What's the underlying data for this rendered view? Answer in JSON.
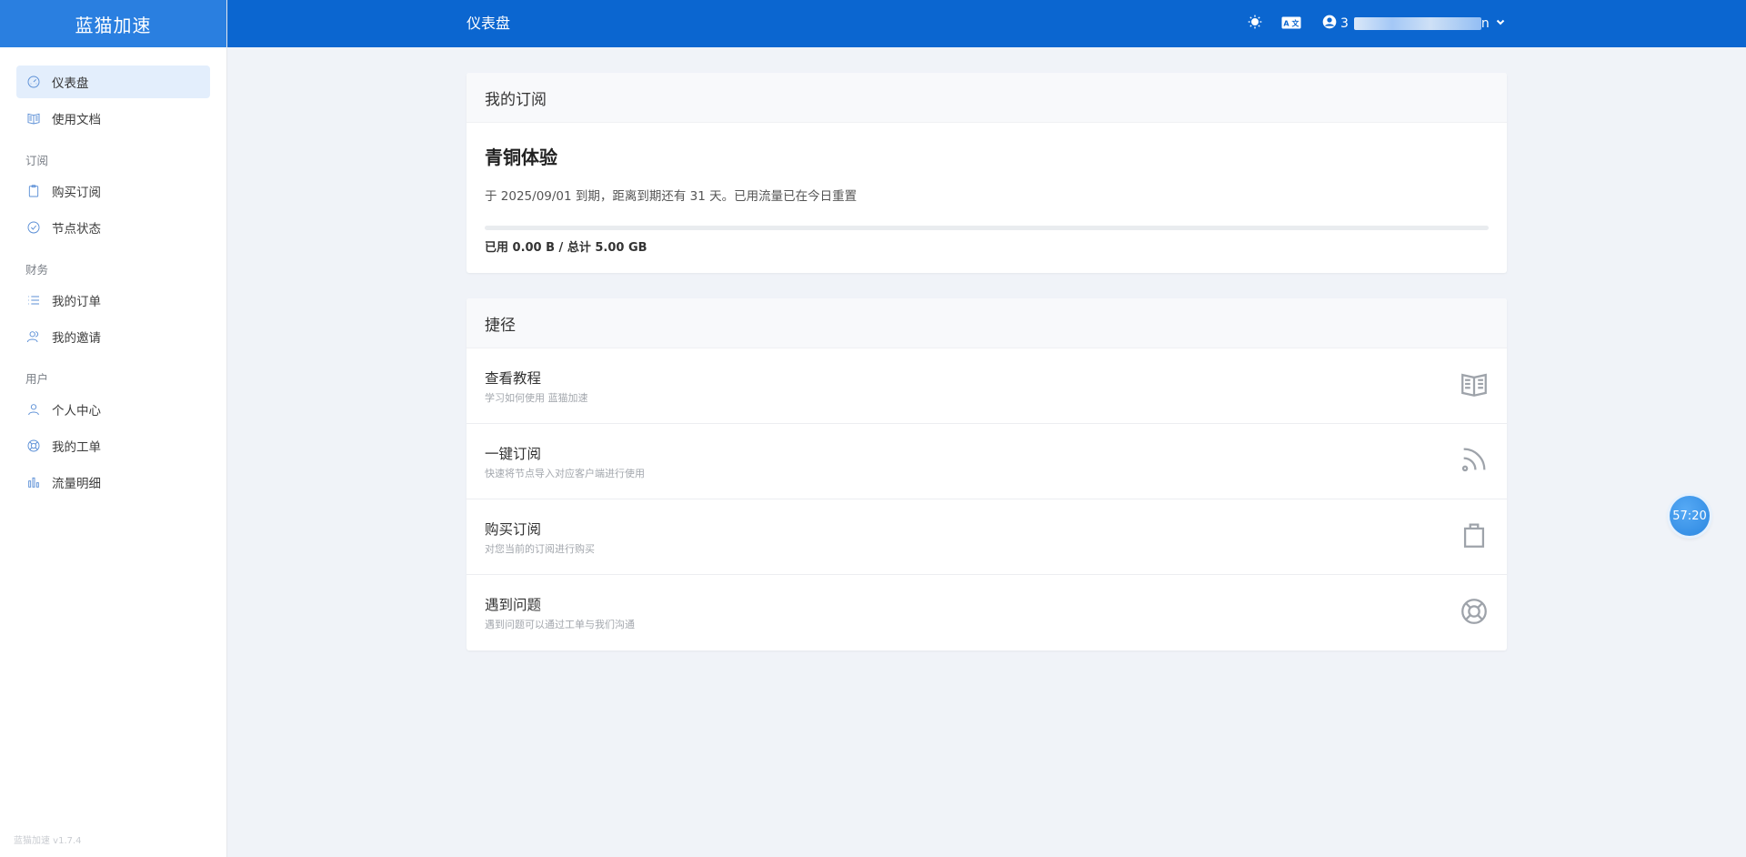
{
  "brand": "蓝猫加速",
  "version": "蓝猫加速 v1.7.4",
  "header": {
    "title": "仪表盘",
    "user_prefix": "3",
    "user_suffix": "n"
  },
  "sidebar": {
    "items_top": [
      {
        "label": "仪表盘",
        "icon": "gauge-icon"
      },
      {
        "label": "使用文档",
        "icon": "book-icon"
      }
    ],
    "groups": [
      {
        "heading": "订阅",
        "items": [
          {
            "label": "购买订阅",
            "icon": "clipboard-icon"
          },
          {
            "label": "节点状态",
            "icon": "check-circle-icon"
          }
        ]
      },
      {
        "heading": "财务",
        "items": [
          {
            "label": "我的订单",
            "icon": "list-icon"
          },
          {
            "label": "我的邀请",
            "icon": "users-icon"
          }
        ]
      },
      {
        "heading": "用户",
        "items": [
          {
            "label": "个人中心",
            "icon": "user-icon"
          },
          {
            "label": "我的工单",
            "icon": "lifebuoy-icon"
          },
          {
            "label": "流量明细",
            "icon": "bar-chart-icon"
          }
        ]
      }
    ]
  },
  "subscription": {
    "card_title": "我的订阅",
    "plan": "青铜体验",
    "expire_text": "于 2025/09/01 到期，距离到期还有 31 天。已用流量已在今日重置",
    "progress_fraction": 0,
    "usage_text": "已用 0.00 B / 总计 5.00 GB"
  },
  "shortcuts": {
    "card_title": "捷径",
    "items": [
      {
        "title": "查看教程",
        "desc": "学习如何使用 蓝猫加速",
        "icon": "book-icon"
      },
      {
        "title": "一键订阅",
        "desc": "快速将节点导入对应客户端进行使用",
        "icon": "rss-icon"
      },
      {
        "title": "购买订阅",
        "desc": "对您当前的订阅进行购买",
        "icon": "shopping-bag-icon"
      },
      {
        "title": "遇到问题",
        "desc": "遇到问题可以通过工单与我们沟通",
        "icon": "lifebuoy-icon"
      }
    ]
  },
  "timer": "57:20",
  "colors": {
    "header": "#0b66d0",
    "brand_bg": "#2a7fe0",
    "active_nav": "#e3eefc"
  }
}
